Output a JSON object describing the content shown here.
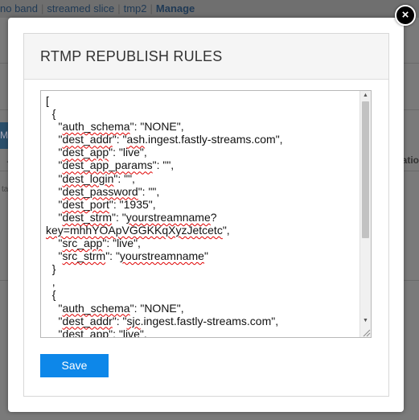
{
  "background": {
    "nav": {
      "items": [
        "no band",
        "streamed slice",
        "tmp2"
      ],
      "active": "Manage",
      "separator": "|"
    },
    "side_tab": "M",
    "right_label": "atio",
    "left_small": "ta",
    "left_arrow": "←"
  },
  "modal": {
    "title": "RTMP REPUBLISH RULES",
    "close_label": "×",
    "editor": {
      "line_open_bracket": "[",
      "block1_open": "  {",
      "b1_auth_key": "auth_schema",
      "b1_auth_val": "\"NONE\",",
      "b1_addr_key": "dest_addr",
      "b1_addr_val_word": "ash",
      "b1_addr_val_rest": ".ingest.fastly-streams.com\",",
      "b1_app_key": "dest_app",
      "b1_app_val": "\"live\",",
      "b1_params_key": "dest_app_params",
      "b1_params_val": "\"\",",
      "b1_login_key": "dest_login",
      "b1_login_val": "\"\",",
      "b1_pass_key": "dest_password",
      "b1_pass_val": "\"\",",
      "b1_port_key": "dest_port",
      "b1_port_val": "\"1935\",",
      "b1_strm_key": "dest_strm",
      "b1_strm_val_word": "yourstreamname",
      "b1_strm_val_rest": "?",
      "b1_strm_cont_word": "key=mhhYOApVGGKKqXyzJetcetc",
      "b1_strm_cont_rest": "\",",
      "b1_src_app_key": "src_app",
      "b1_src_app_val": "\"live\",",
      "b1_src_strm_key": "src_strm",
      "b1_src_strm_val_word": "yourstreamname",
      "block1_close": "  }",
      "comma": "  ,",
      "block2_open": "  {",
      "b2_auth_key": "auth_schema",
      "b2_auth_val": "\"NONE\",",
      "b2_addr_key": "dest_addr",
      "b2_addr_val_word": "sjc",
      "b2_addr_val_rest": ".ingest.fastly-streams.com\",",
      "b2_app_key": "dest_app",
      "b2_app_val": "\"live\","
    },
    "save_label": "Save"
  },
  "colors": {
    "accent": "#0d87e9",
    "spellcheck": "#e00000"
  }
}
